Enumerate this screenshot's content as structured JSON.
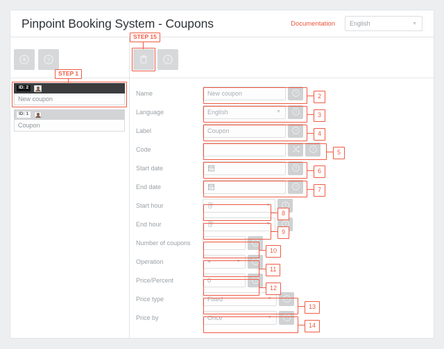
{
  "header": {
    "title": "Pinpoint Booking System - Coupons",
    "documentation_label": "Documentation",
    "language_value": "English",
    "caret": "▼"
  },
  "left_toolbar": {
    "add_label": "add-icon",
    "help_label": "help-icon"
  },
  "right_toolbar": {
    "delete_label": "trash-icon",
    "help_label": "help-icon"
  },
  "coupon_list": [
    {
      "id_label": "ID: 2",
      "name": "New coupon",
      "selected": true
    },
    {
      "id_label": "ID: 1",
      "name": "Coupon",
      "selected": false
    }
  ],
  "form": {
    "rows": [
      {
        "label": "Name",
        "value": "New coupon",
        "kind": "text"
      },
      {
        "label": "Language",
        "value": "English",
        "kind": "select"
      },
      {
        "label": "Label",
        "value": "Coupon",
        "kind": "text"
      },
      {
        "label": "Code",
        "value": "",
        "kind": "code"
      },
      {
        "label": "Start date",
        "value": "",
        "kind": "date"
      },
      {
        "label": "End date",
        "value": "",
        "kind": "date"
      },
      {
        "label": "Start hour",
        "value": "",
        "kind": "hour"
      },
      {
        "label": "End hour",
        "value": "",
        "kind": "hour"
      },
      {
        "label": "Number of coupons",
        "value": "",
        "kind": "number"
      },
      {
        "label": "Operation",
        "value": "+",
        "kind": "smallselect"
      },
      {
        "label": "Price/Percent",
        "value": "0",
        "kind": "number"
      },
      {
        "label": "Price type",
        "value": "Fixed",
        "kind": "select"
      },
      {
        "label": "Price by",
        "value": "Once",
        "kind": "select"
      }
    ],
    "caret": "▼"
  },
  "annotations": {
    "step_1": "STEP 1",
    "step_15": "STEP 15",
    "numbers": [
      "2",
      "3",
      "4",
      "5",
      "6",
      "7",
      "8",
      "9",
      "10",
      "11",
      "12",
      "13",
      "14"
    ]
  },
  "colors": {
    "accent_red": "#ef5a43",
    "doc_link": "#e8553c",
    "title": "#2f3337",
    "muted_text": "#9aa0a6",
    "panel_bg": "#ffffff",
    "page_bg": "#eceef0",
    "selected_row": "#3a3c3e",
    "toolbar_btn": "#d6d8da"
  }
}
